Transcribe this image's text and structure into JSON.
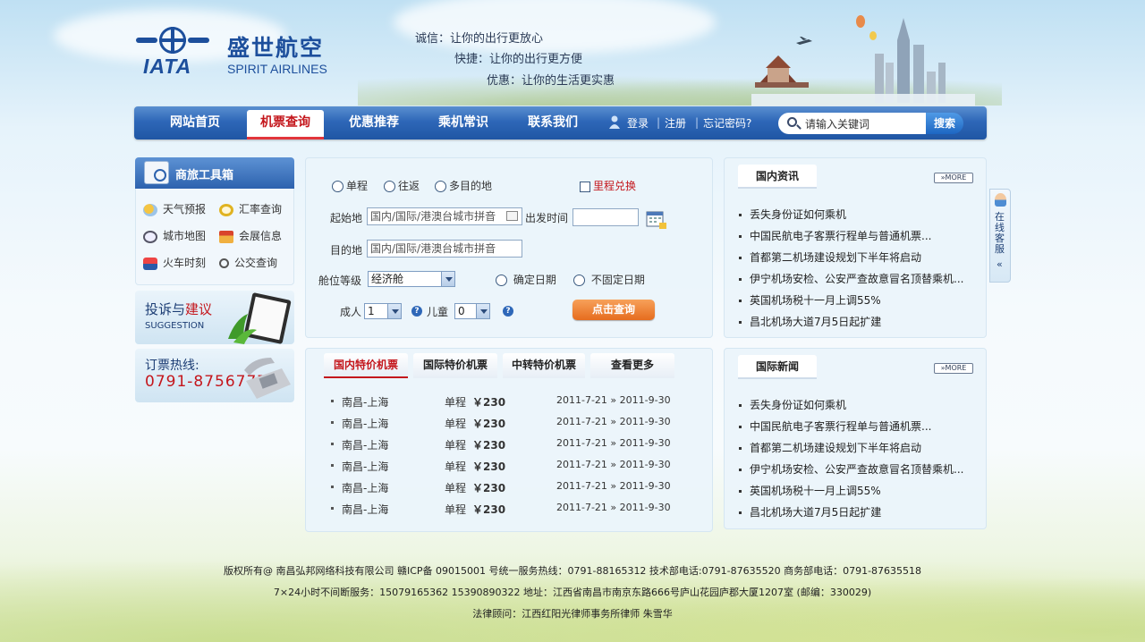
{
  "brand": {
    "logo_text": "IATA",
    "name_cn": "盛世航空",
    "name_en": "SPIRIT AIRLINES"
  },
  "slogans": [
    "诚信：让你的出行更放心",
    "快捷：让你的出行更方便",
    "优惠：让你的生活更实惠"
  ],
  "nav": {
    "items": [
      {
        "label": "网站首页",
        "active": false
      },
      {
        "label": "机票查询",
        "active": true
      },
      {
        "label": "优惠推荐",
        "active": false
      },
      {
        "label": "乘机常识",
        "active": false
      },
      {
        "label": "联系我们",
        "active": false
      }
    ],
    "login": "登录",
    "register": "注册",
    "forgot": "忘记密码?",
    "separator": "|",
    "search_placeholder": "请输入关键词",
    "search_button": "搜索"
  },
  "sidebar": {
    "tools_title": "商旅工具箱",
    "tools": [
      {
        "label": "天气预报",
        "icon": "weather-icon"
      },
      {
        "label": "汇率查询",
        "icon": "exchange-rate-icon"
      },
      {
        "label": "城市地图",
        "icon": "globe-icon"
      },
      {
        "label": "会展信息",
        "icon": "exhibition-icon"
      },
      {
        "label": "火车时刻",
        "icon": "train-icon"
      },
      {
        "label": "公交查询",
        "icon": "bus-search-icon"
      }
    ],
    "suggestion_title_a": "投诉与",
    "suggestion_title_b": "建议",
    "suggestion_en": "SUGGESTION",
    "hotline_label": "订票热线:",
    "hotline_number": "0791-87567777"
  },
  "booking": {
    "trip_types": [
      "单程",
      "往返",
      "多目的地"
    ],
    "mileage": "里程兑换",
    "from_label": "起始地",
    "from_placeholder": "国内/国际/港澳台城市拼音",
    "depart_label": "出发时间",
    "to_label": "目的地",
    "to_placeholder": "国内/国际/港澳台城市拼音",
    "cabin_label": "舱位等级",
    "cabin_value": "经济舱",
    "date_options": [
      "确定日期",
      "不固定日期"
    ],
    "adult_label": "成人",
    "adult_value": "1",
    "child_label": "儿童",
    "child_value": "0",
    "help_glyph": "?",
    "submit": "点击查询"
  },
  "specials": {
    "tabs": [
      {
        "label": "国内特价机票",
        "active": true
      },
      {
        "label": "国际特价机票",
        "active": false
      },
      {
        "label": "中转特价机票",
        "active": false
      },
      {
        "label": "查看更多",
        "active": false
      }
    ],
    "rows": [
      {
        "route": "南昌-上海",
        "type": "单程",
        "price": "￥230",
        "dates": "2011-7-21 » 2011-9-30"
      },
      {
        "route": "南昌-上海",
        "type": "单程",
        "price": "￥230",
        "dates": "2011-7-21 » 2011-9-30"
      },
      {
        "route": "南昌-上海",
        "type": "单程",
        "price": "￥230",
        "dates": "2011-7-21 » 2011-9-30"
      },
      {
        "route": "南昌-上海",
        "type": "单程",
        "price": "￥230",
        "dates": "2011-7-21 » 2011-9-30"
      },
      {
        "route": "南昌-上海",
        "type": "单程",
        "price": "￥230",
        "dates": "2011-7-21 » 2011-9-30"
      },
      {
        "route": "南昌-上海",
        "type": "单程",
        "price": "￥230",
        "dates": "2011-7-21 » 2011-9-30"
      }
    ]
  },
  "news_domestic": {
    "title": "国内资讯",
    "more": "MORE",
    "items": [
      "丢失身份证如何乘机",
      "中国民航电子客票行程单与普通机票...",
      "首都第二机场建设规划下半年将启动",
      "伊宁机场安检、公安严查故意冒名顶替乘机...",
      "英国机场税十一月上调55%",
      "昌北机场大道7月5日起扩建"
    ]
  },
  "news_international": {
    "title": "国际新闻",
    "more": "MORE",
    "items": [
      "丢失身份证如何乘机",
      "中国民航电子客票行程单与普通机票...",
      "首都第二机场建设规划下半年将启动",
      "伊宁机场安检、公安严查故意冒名顶替乘机...",
      "英国机场税十一月上调55%",
      "昌北机场大道7月5日起扩建"
    ]
  },
  "service_tab": {
    "label": "在线客服",
    "arrow": "«"
  },
  "footer": {
    "line1": "版权所有@ 南昌弘邦网络科技有限公司 赣ICP备 09015001 号统一服务热线：0791-88165312 技术部电话:0791-87635520 商务部电话：0791-87635518",
    "line2": "7×24小时不间断服务：15079165362 15390890322 地址：江西省南昌市南京东路666号庐山花园庐郡大厦1207室 (邮编：330029)",
    "line3": "法律顾问：江西红阳光律师事务所律师 朱雪华"
  },
  "colors": {
    "nav_blue": "#2e67b8",
    "accent_red": "#c4161c",
    "button_orange": "#e66c1e"
  }
}
